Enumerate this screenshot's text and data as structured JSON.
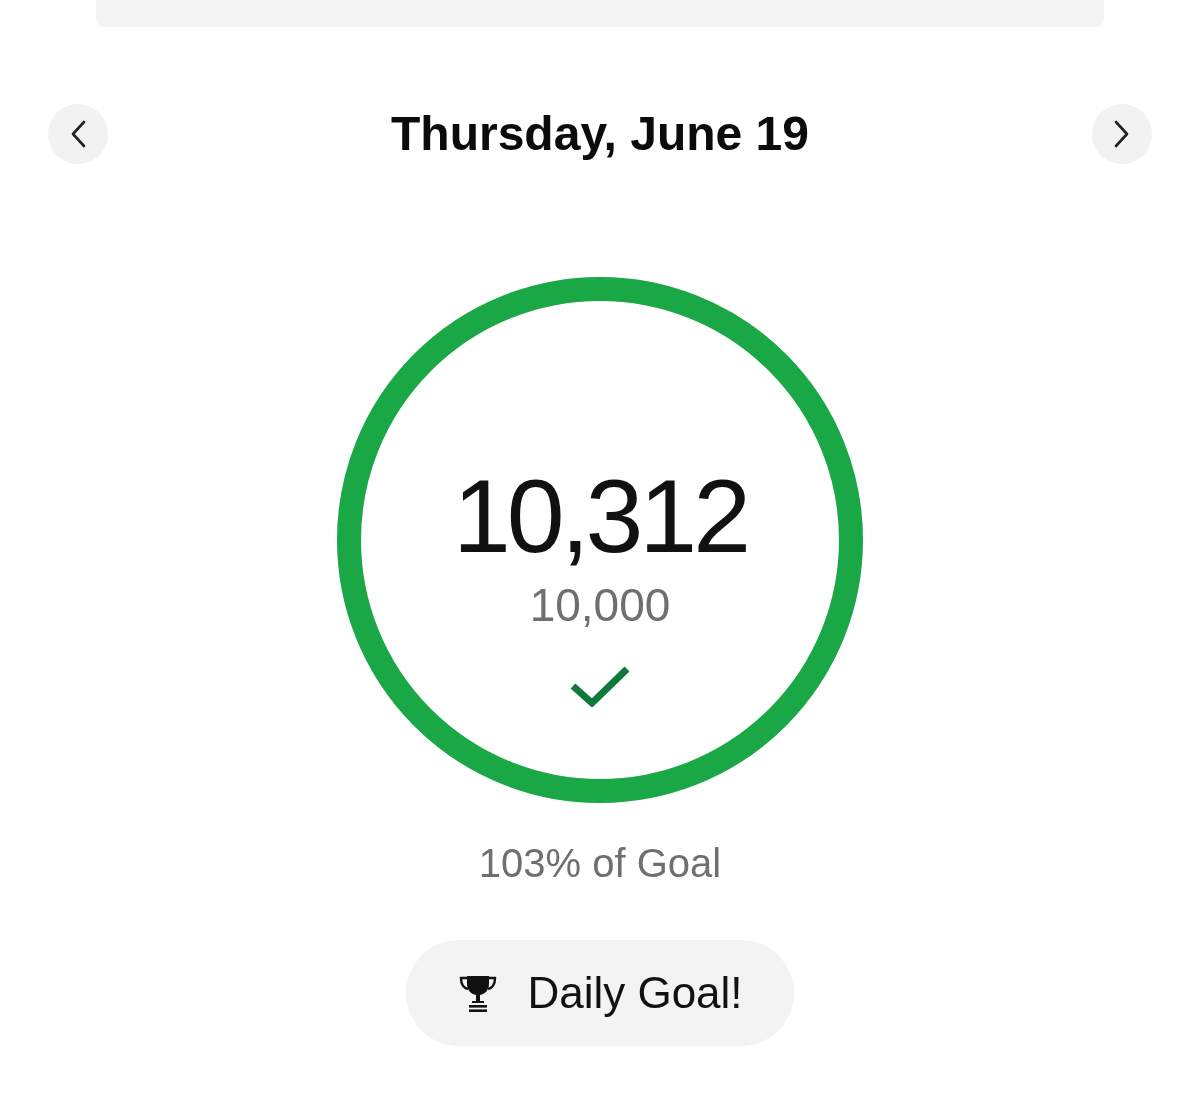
{
  "date_nav": {
    "title": "Thursday, June 19"
  },
  "progress_ring": {
    "level": 1,
    "steps": "10,312",
    "goal": "10,000",
    "goal_met": true
  },
  "percent_label": "103% of Goal",
  "achievement": {
    "label": "Daily Goal!"
  }
}
